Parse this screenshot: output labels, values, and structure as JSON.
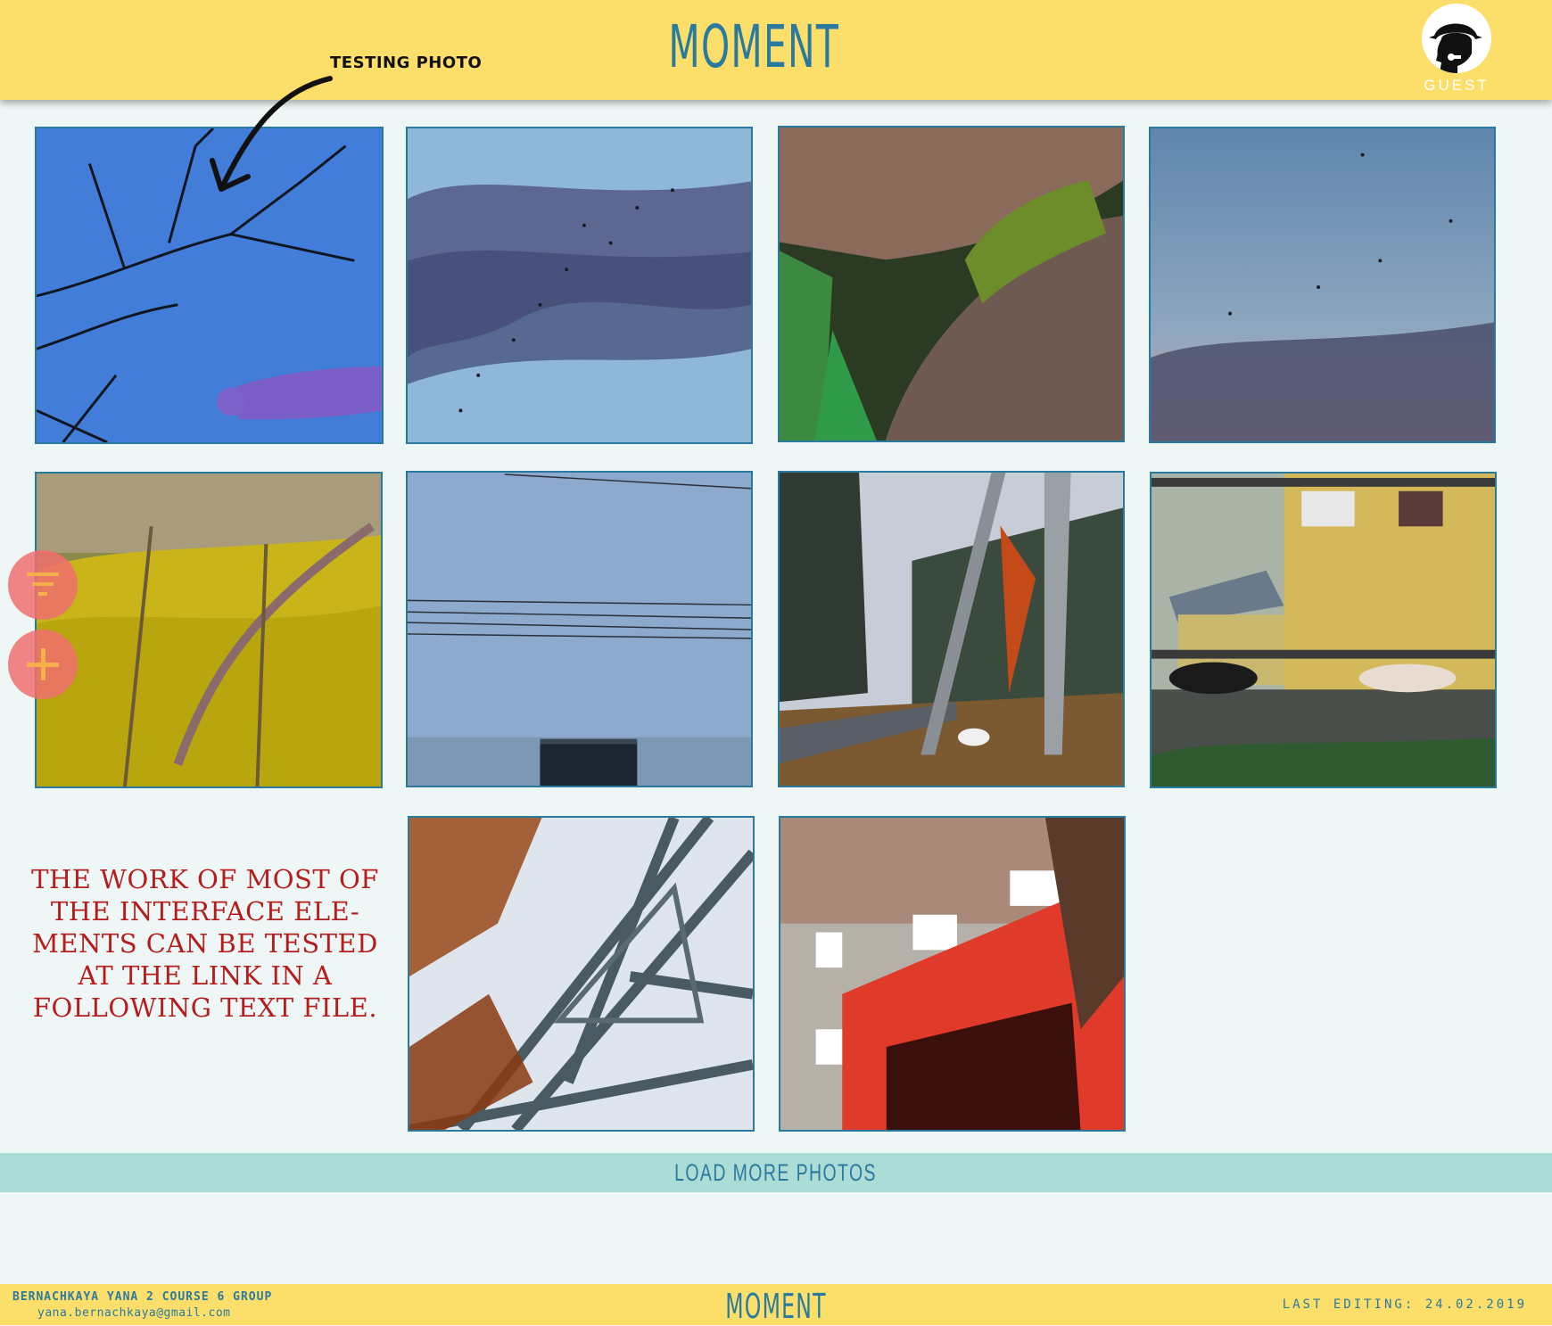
{
  "header": {
    "logo": "MOMENT",
    "user_label": "GUEST"
  },
  "annotation": {
    "label": "TESTING PHOTO"
  },
  "photos": [
    {
      "subject": "hand reaching toward bare branches with blue lights"
    },
    {
      "subject": "flock of birds in cloudy sky"
    },
    {
      "subject": "moss on tree bark with green leaves"
    },
    {
      "subject": "birds in evening sky"
    },
    {
      "subject": "yellow moss and dry grass"
    },
    {
      "subject": "power lines over foggy field"
    },
    {
      "subject": "white dog under autumn trees and poles"
    },
    {
      "subject": "cats on wall behind railing"
    },
    {
      "subject": "steel bridge truss with autumn leaves"
    },
    {
      "subject": "red building entrance with autumn branches"
    }
  ],
  "side_buttons": {
    "filter_icon": "filter-icon",
    "add_icon": "plus-icon"
  },
  "note": {
    "lines": [
      "THE WORK OF MOST OF",
      "THE INTERFACE ELE-",
      "MENTS CAN BE TESTED",
      "AT THE LINK IN A",
      "FOLLOWING TEXT FILE."
    ]
  },
  "load_more": {
    "label": "LOAD MORE PHOTOS"
  },
  "footer": {
    "author": "BERNACHKAYA YANA 2 COURSE 6 GROUP",
    "email": "yana.bernachkaya@gmail.com",
    "logo": "MOMENT",
    "last_editing": "LAST EDITING: 24.02.2019"
  },
  "colors": {
    "header": "#fcdf6a",
    "accent": "#2a7aa0",
    "load_bar": "#acdcd6",
    "note": "#b51d1d",
    "fab": "#f06e6e"
  }
}
